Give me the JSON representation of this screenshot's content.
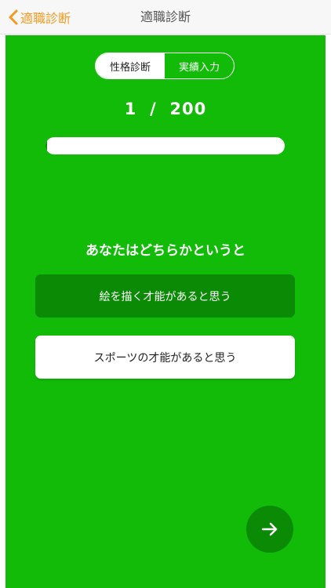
{
  "navbar": {
    "back_label": "適職診断",
    "title": "適職診断"
  },
  "segment": {
    "tabs": [
      {
        "label": "性格診断",
        "active": true
      },
      {
        "label": "実績入力",
        "active": false
      }
    ]
  },
  "progress": {
    "current": "1",
    "total": "200",
    "separator": "/",
    "fraction": 0.005
  },
  "question": {
    "text": "あなたはどちらかというと",
    "choices": [
      {
        "label": "絵を描く才能があると思う",
        "selected": true
      },
      {
        "label": "スポーツの才能があると思う",
        "selected": false
      }
    ]
  },
  "icons": {
    "back": "chevron-left-icon",
    "next": "arrow-right-icon"
  },
  "colors": {
    "background": "#11bb07",
    "accent": "#f39a1e",
    "selected_choice": "#0b8a06",
    "white": "#ffffff"
  }
}
